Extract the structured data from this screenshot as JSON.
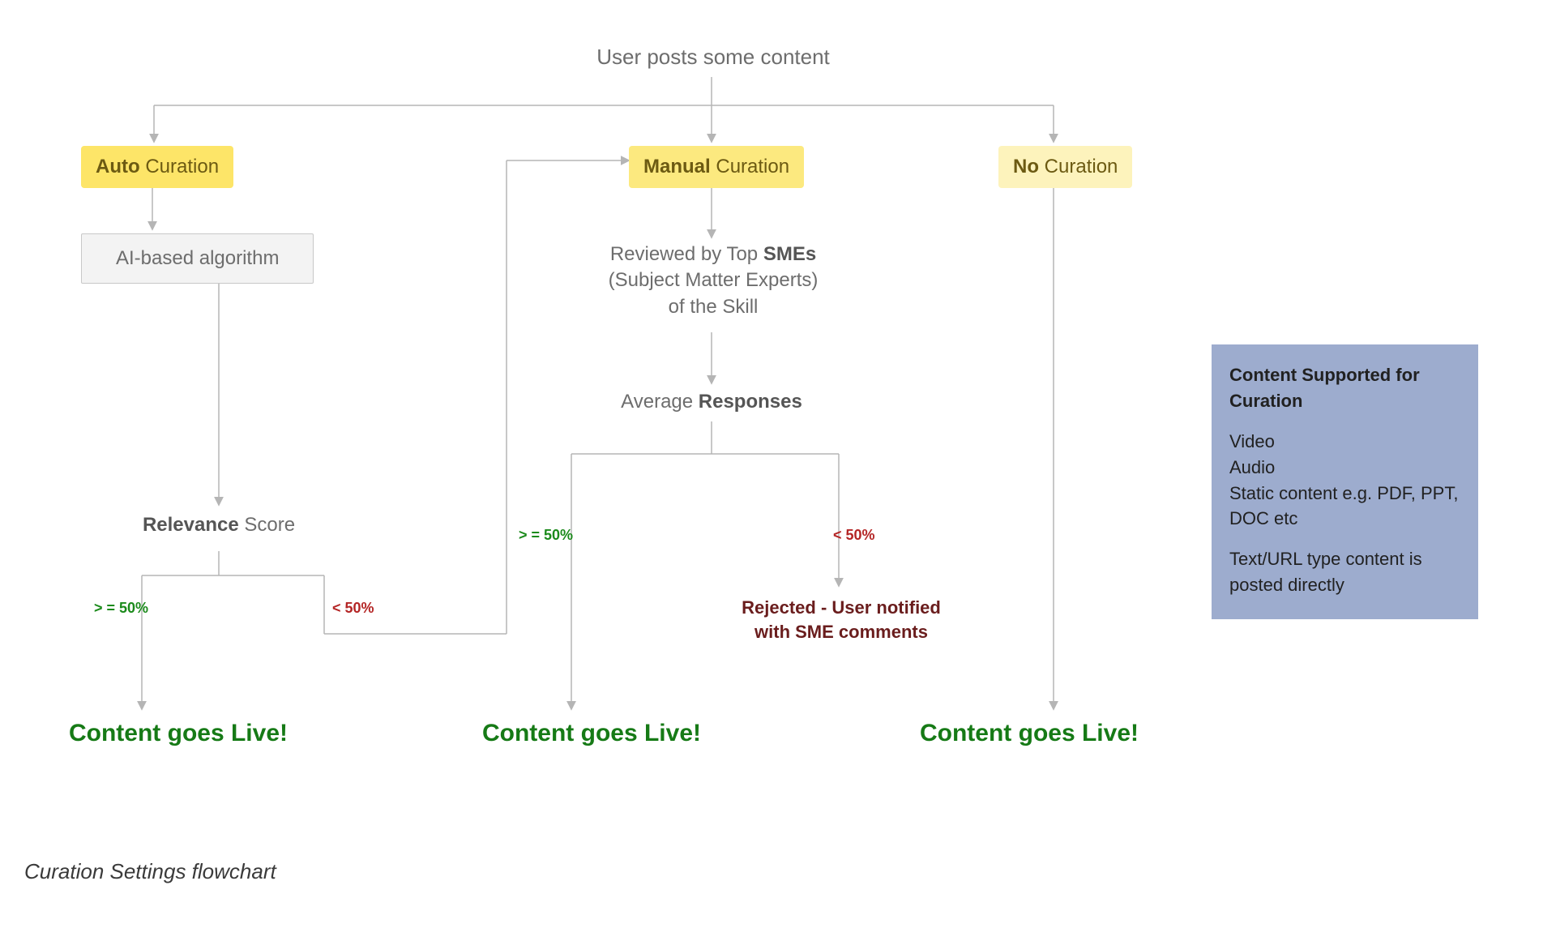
{
  "top": {
    "label": "User posts some content"
  },
  "auto": {
    "pill_bold": "Auto",
    "pill_rest": " Curation"
  },
  "manual": {
    "pill_bold": "Manual",
    "pill_rest": " Curation"
  },
  "none": {
    "pill_bold": "No",
    "pill_rest": " Curation"
  },
  "algo": {
    "label": "AI-based algorithm"
  },
  "relevance": {
    "bold": "Relevance",
    "rest": " Score"
  },
  "sme": {
    "line1_pre": "Reviewed by Top ",
    "line1_bold": "SMEs",
    "line2": "(Subject Matter Experts)",
    "line3": "of the Skill"
  },
  "avg": {
    "pre": "Average ",
    "bold": "Responses"
  },
  "thresholds": {
    "gte": "> = 50%",
    "lt": "< 50%"
  },
  "rejected": {
    "line1": "Rejected - User notified",
    "line2": "with SME comments"
  },
  "live": {
    "label": "Content goes Live!"
  },
  "sidebox": {
    "header": "Content Supported for Curation",
    "items": [
      "Video",
      "Audio",
      "Static content e.g. PDF, PPT, DOC etc"
    ],
    "footnote": "Text/URL type content is posted directly"
  },
  "caption": "Curation Settings flowchart"
}
